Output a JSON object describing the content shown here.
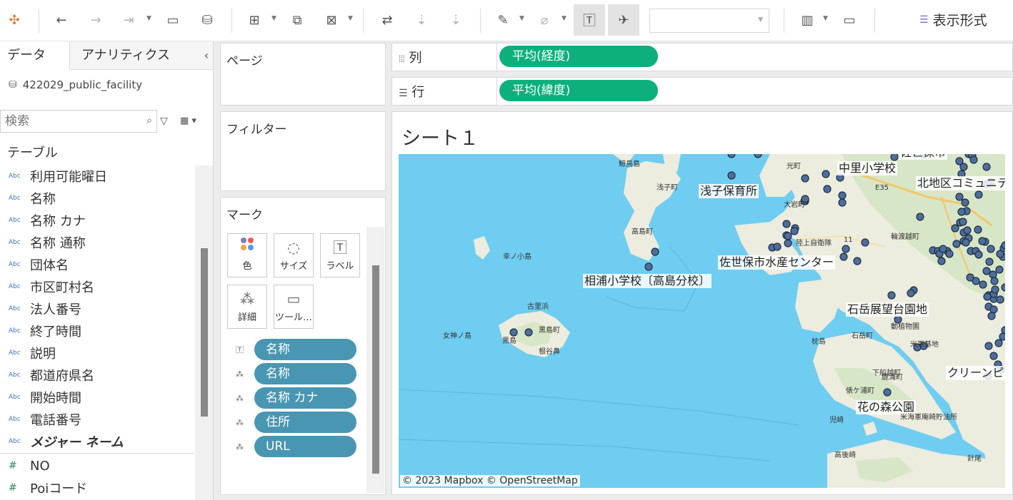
{
  "toolbar": {
    "show_me_label": "表示形式",
    "buttons": [
      "logo-icon",
      "undo-icon",
      "redo-icon",
      "replay-icon",
      "save-icon",
      "new-datasource-icon",
      "new-worksheet-icon",
      "duplicate-icon",
      "clear-icon",
      "swap-icon",
      "sort-asc-icon",
      "sort-desc-icon",
      "highlight-icon",
      "attach-icon",
      "show-labels-icon",
      "pin-icon",
      "chart-type-icon",
      "presentation-icon"
    ]
  },
  "left_pane": {
    "tab_data": "データ",
    "tab_analytics": "アナリティクス",
    "collapse": "‹",
    "datasource": "422029_public_facility",
    "search_placeholder": "検索",
    "table_section": "テーブル",
    "dimension_type": "Abc",
    "measure_type": "#",
    "dimensions": [
      "利用可能曜日",
      "名称",
      "名称 カナ",
      "名称 通称",
      "団体名",
      "市区町村名",
      "法人番号",
      "終了時間",
      "説明",
      "都道府県名",
      "開始時間",
      "電話番号",
      "メジャー ネーム"
    ],
    "measures": [
      "NO",
      "Poiコード"
    ]
  },
  "pages_card": {
    "title": "ページ"
  },
  "filters_card": {
    "title": "フィルター"
  },
  "marks_card": {
    "title": "マーク",
    "buttons": {
      "color": "色",
      "size": "サイズ",
      "label": "ラベル",
      "detail": "詳細",
      "tooltip": "ツール…"
    },
    "fields": [
      "名称",
      "名称",
      "名称 カナ",
      "住所",
      "URL"
    ]
  },
  "shelves": {
    "columns_label": "列",
    "columns_pill": "平均(経度)",
    "rows_label": "行",
    "rows_pill": "平均(緯度)"
  },
  "view": {
    "sheet_title": "シート１",
    "attribution": "© 2023 Mapbox © OpenStreetMap",
    "labels": {
      "asako": "浅子保育所",
      "nakazato": "中里小学校",
      "kitachiku": "北地区コミュニティ",
      "sasebo_suisan": "佐世保市水産センター",
      "ainoura": "相浦小学校〔高島分校〕",
      "ishidake": "石岳展望台園地",
      "clean": "クリーンピュア",
      "hananomori": "花の森公園",
      "top_cut": "佐世保市"
    },
    "places": [
      "鯨鳥島",
      "浅子町",
      "高島町",
      "幸ノ小島",
      "古里浜",
      "黒島",
      "黒島町",
      "女神ノ島",
      "根谷鼻",
      "光町",
      "大岩町",
      "陸上自衛隊",
      "輪渡越町",
      "枕島",
      "石岳町",
      "動植物園",
      "米軍基地",
      "下船越町",
      "俵ケ浦町",
      "鹿浦町",
      "高後崎",
      "児崎",
      "米海軍庵崎貯油所",
      "針尾",
      "E35",
      "11"
    ]
  }
}
